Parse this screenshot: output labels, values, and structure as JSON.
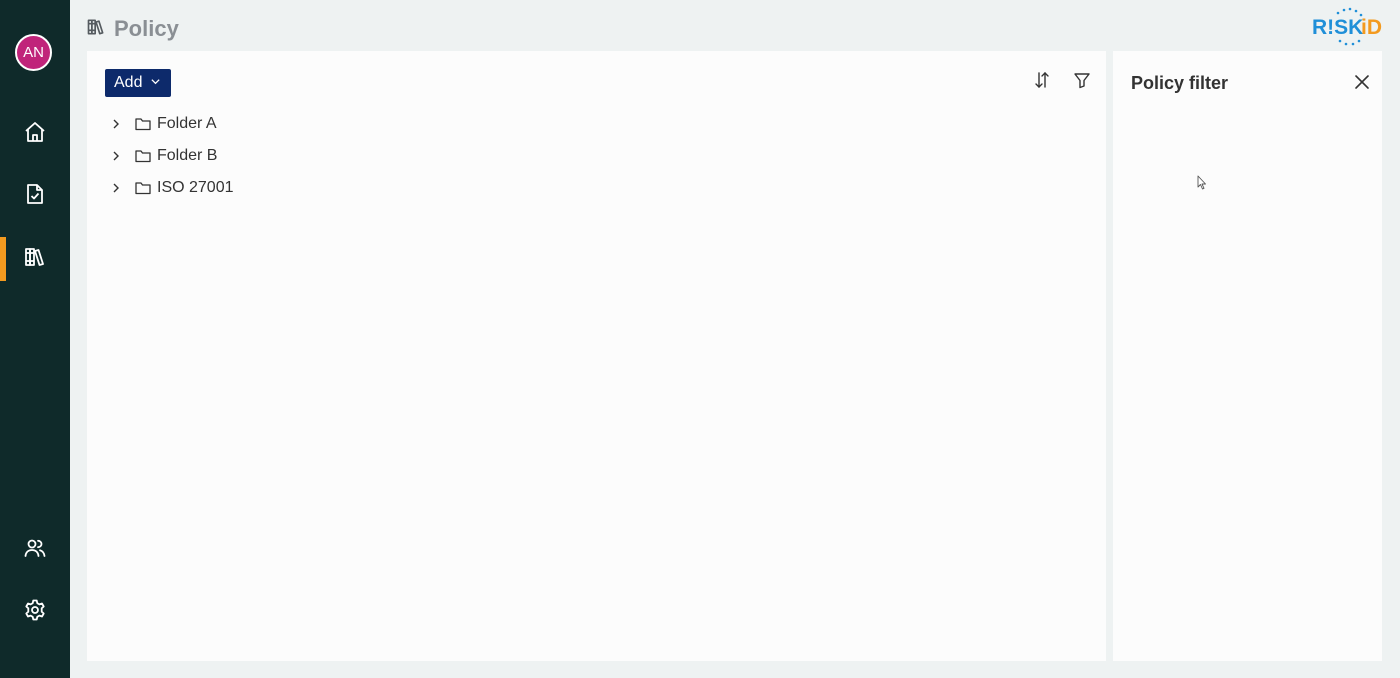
{
  "sidebar": {
    "avatar_initials": "AN",
    "items": [
      {
        "name": "home",
        "icon": "home-icon"
      },
      {
        "name": "tasks",
        "icon": "document-check-icon"
      },
      {
        "name": "policy",
        "icon": "library-icon",
        "active": true
      },
      {
        "name": "users",
        "icon": "users-icon"
      },
      {
        "name": "settings",
        "icon": "gear-icon"
      }
    ],
    "active_color": "#f39a1f",
    "background": "#0f2a2a"
  },
  "header": {
    "title": "Policy",
    "icon": "library-icon"
  },
  "logo": {
    "text_blue": "R!SK",
    "text_orange": "iD"
  },
  "toolbar": {
    "add_label": "Add",
    "sort_icon": "sort-icon",
    "filter_icon": "filter-icon"
  },
  "tree": {
    "items": [
      {
        "label": "Folder A"
      },
      {
        "label": "Folder B"
      },
      {
        "label": "ISO 27001"
      }
    ]
  },
  "filter_panel": {
    "title": "Policy filter"
  },
  "colors": {
    "accent_navy": "#0d2a6b",
    "avatar": "#c0247a",
    "logo_blue": "#1f8fd8",
    "logo_orange": "#f39a1f"
  }
}
